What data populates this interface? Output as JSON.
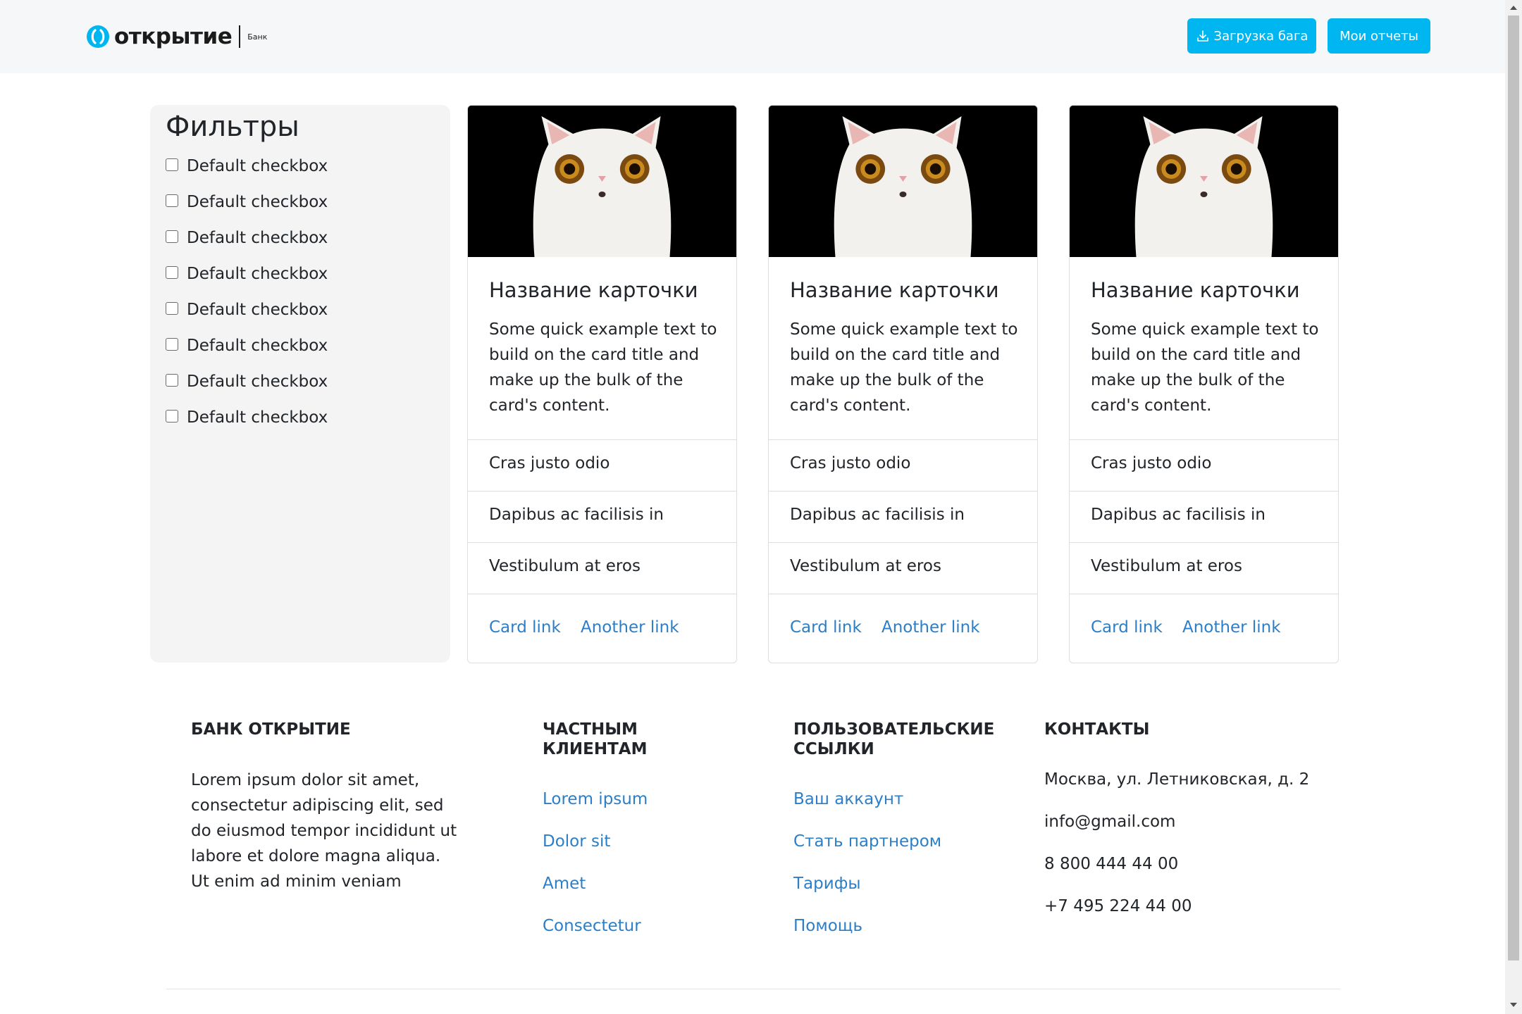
{
  "header": {
    "logo": {
      "word": "открытие",
      "sub": "Банк",
      "icon": "otkritie-logo-icon"
    },
    "buttons": {
      "upload_label": "Загрузка бага",
      "upload_icon": "download-icon",
      "reports_label": "Мои отчеты"
    },
    "accent": "#00b6f0"
  },
  "filters": {
    "title": "Фильтры",
    "items": [
      {
        "label": "Default checkbox",
        "checked": false
      },
      {
        "label": "Default checkbox",
        "checked": false
      },
      {
        "label": "Default checkbox",
        "checked": false
      },
      {
        "label": "Default checkbox",
        "checked": false
      },
      {
        "label": "Default checkbox",
        "checked": false
      },
      {
        "label": "Default checkbox",
        "checked": false
      },
      {
        "label": "Default checkbox",
        "checked": false
      },
      {
        "label": "Default checkbox",
        "checked": false
      }
    ]
  },
  "cards": [
    {
      "image": "white-cat-photo",
      "title": "Название карточки",
      "text": "Some quick example text to build on the card title and make up the bulk of the card's content.",
      "list": [
        "Cras justo odio",
        "Dapibus ac facilisis in",
        "Vestibulum at eros"
      ],
      "link1": "Card link",
      "link2": "Another link"
    },
    {
      "image": "white-cat-photo",
      "title": "Название карточки",
      "text": "Some quick example text to build on the card title and make up the bulk of the card's content.",
      "list": [
        "Cras justo odio",
        "Dapibus ac facilisis in",
        "Vestibulum at eros"
      ],
      "link1": "Card link",
      "link2": "Another link"
    },
    {
      "image": "white-cat-photo",
      "title": "Название карточки",
      "text": "Some quick example text to build on the card title and make up the bulk of the card's content.",
      "list": [
        "Cras justo odio",
        "Dapibus ac facilisis in",
        "Vestibulum at eros"
      ],
      "link1": "Card link",
      "link2": "Another link"
    }
  ],
  "footer": {
    "about": {
      "heading": "БАНК ОТКРЫТИЕ",
      "text": "Lorem ipsum dolor sit amet, consectetur adipiscing elit, sed do eiusmod tempor incididunt ut labore et dolore magna aliqua. Ut enim ad minim veniam"
    },
    "private": {
      "heading_line1": "ЧАСТНЫМ",
      "heading_line2": "КЛИЕНТАМ",
      "links": [
        "Lorem ipsum",
        "Dolor sit",
        "Amet",
        "Consectetur"
      ]
    },
    "user_links": {
      "heading_line1": "ПОЛЬЗОВАТЕЛЬСКИЕ",
      "heading_line2": "ССЫЛКИ",
      "links": [
        "Ваш аккаунт",
        "Стать партнером",
        "Тарифы",
        "Помощь"
      ]
    },
    "contacts": {
      "heading": "КОНТАКТЫ",
      "items": [
        "Москва, ул. Летниковская, д. 2",
        "info@gmail.com",
        "8 800 444 44 00",
        "+7 495 224 44 00"
      ]
    }
  },
  "colors": {
    "link": "#2c7ec7",
    "panel": "#f4f4f4",
    "header_bg": "#f6f7f8"
  }
}
